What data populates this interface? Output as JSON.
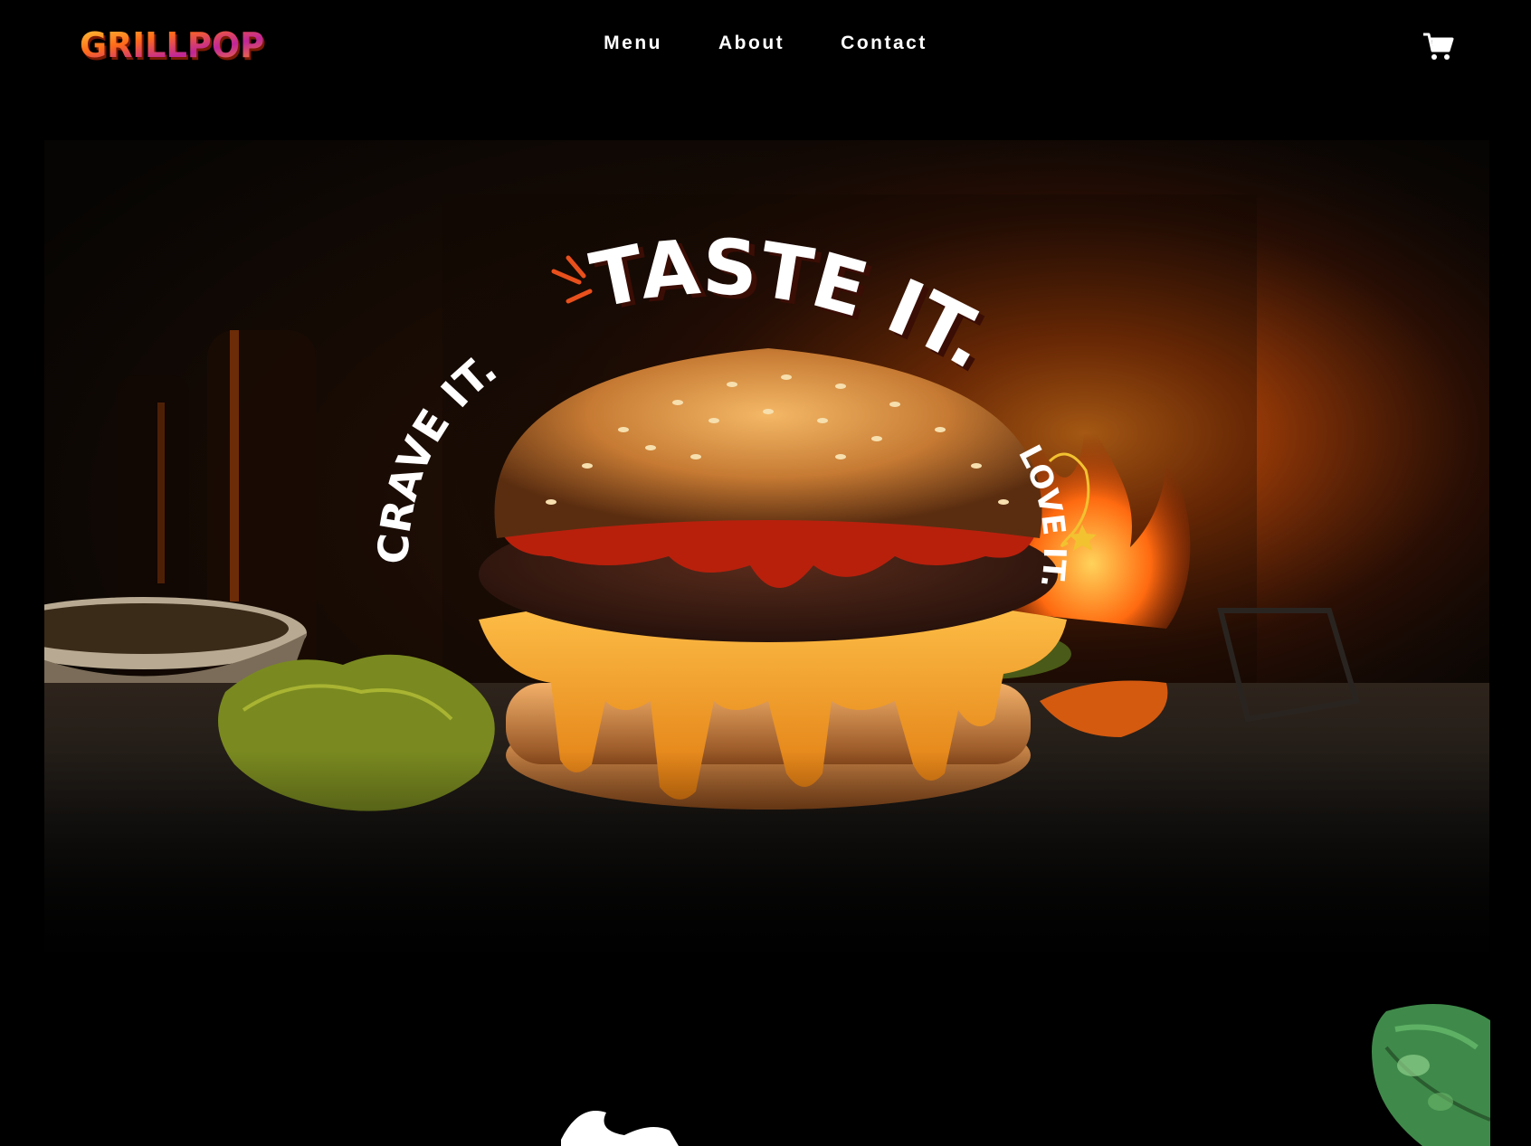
{
  "brand": {
    "logo_text": "GRILLPOP"
  },
  "nav": {
    "links": [
      "Menu",
      "About",
      "Contact"
    ],
    "cart_icon": "cart-icon"
  },
  "hero": {
    "headline_main": "TASTE IT.",
    "headline_left": "CRAVE IT.",
    "headline_right": "LOVE IT.",
    "image_subject": "burger",
    "colors": {
      "background": "#000000",
      "fire": "#ff6a00",
      "accent": "#e9501c",
      "cheese": "#ffb020",
      "text": "#ffffff"
    }
  },
  "decor": {
    "leaf_icon": "leaf-illustration"
  }
}
